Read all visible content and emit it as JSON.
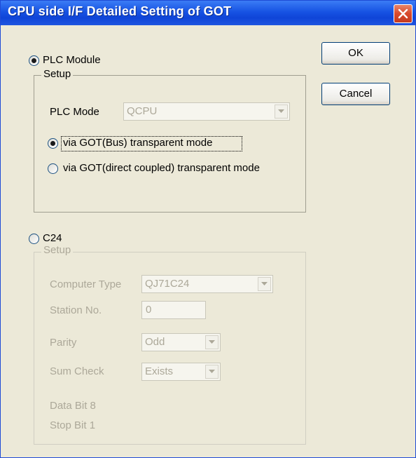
{
  "window": {
    "title": "CPU side I/F Detailed Setting of GOT"
  },
  "buttons": {
    "ok": "OK",
    "cancel": "Cancel"
  },
  "plc_module": {
    "radio_label": "PLC Module",
    "selected": true,
    "group_title": "Setup",
    "plc_mode_label": "PLC Mode",
    "plc_mode_value": "QCPU",
    "option_bus": "via GOT(Bus) transparent mode",
    "option_direct": "via GOT(direct coupled) transparent mode",
    "selected_option": "bus"
  },
  "c24": {
    "radio_label": "C24",
    "selected": false,
    "group_title": "Setup",
    "computer_type_label": "Computer Type",
    "computer_type_value": "QJ71C24",
    "station_label": "Station No.",
    "station_value": "0",
    "parity_label": "Parity",
    "parity_value": "Odd",
    "sum_check_label": "Sum Check",
    "sum_check_value": "Exists",
    "data_bit": "Data Bit  8",
    "stop_bit": "Stop Bit  1"
  },
  "colors": {
    "titlebar": "#0f45d8",
    "dialog_bg": "#ece9d8",
    "disabled_text": "#aca899"
  }
}
